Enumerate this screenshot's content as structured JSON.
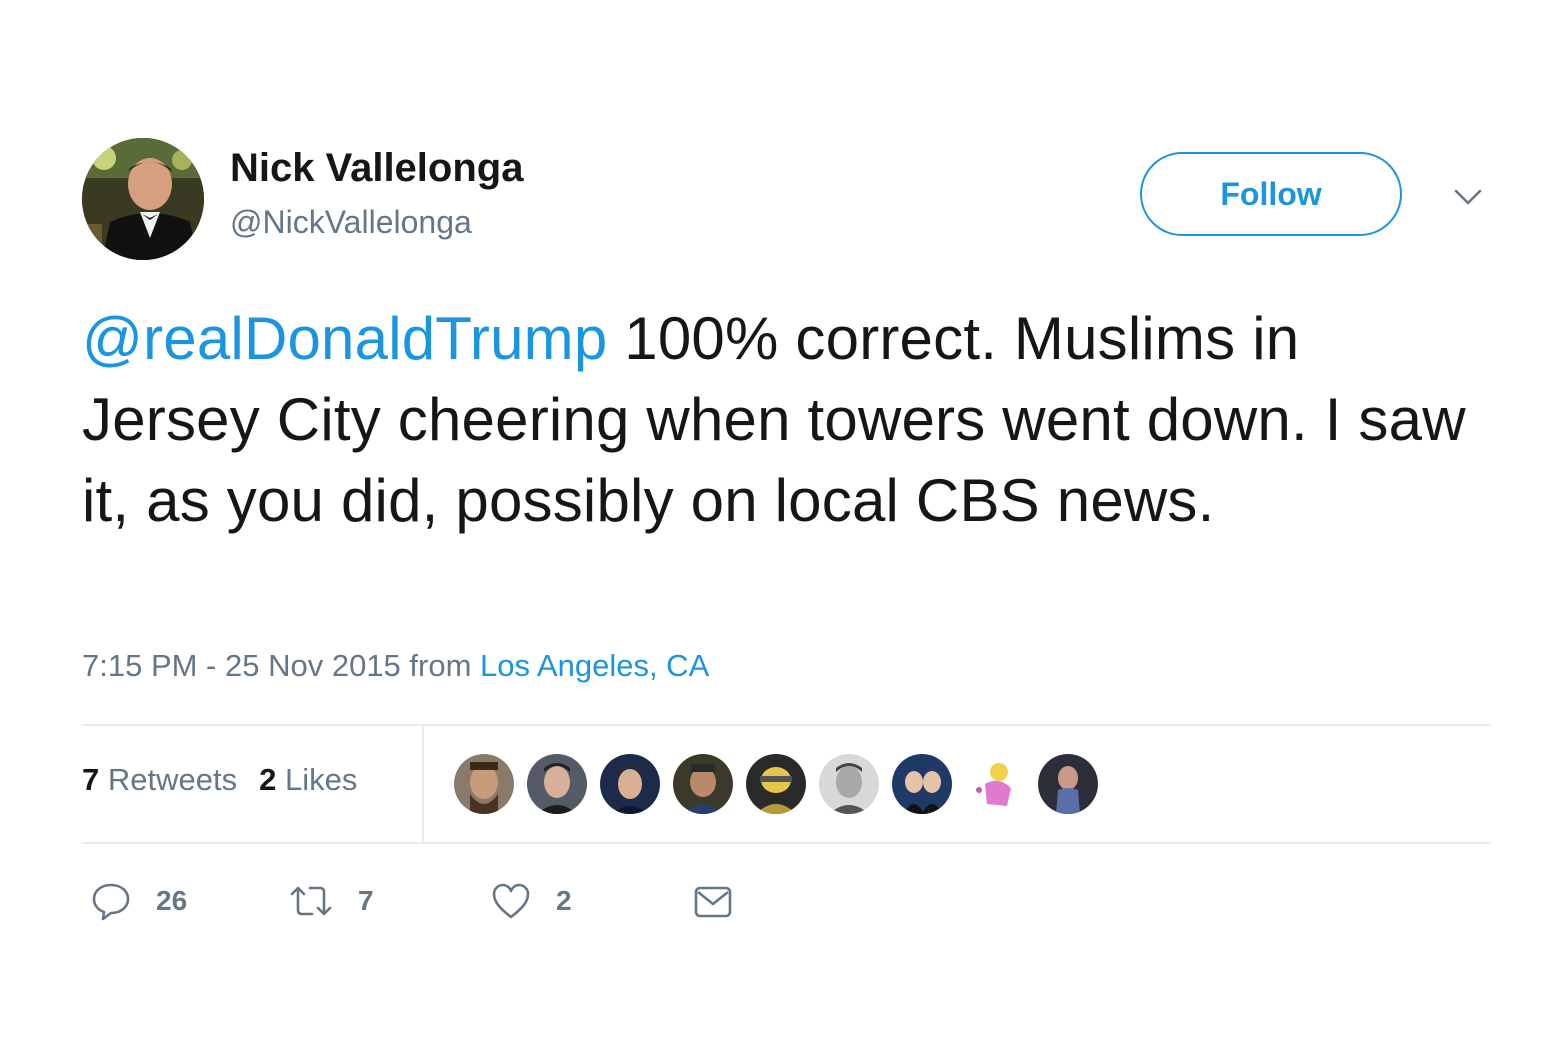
{
  "user": {
    "display_name": "Nick Vallelonga",
    "screen_name": "@NickVallelonga"
  },
  "header": {
    "follow_label": "Follow"
  },
  "tweet": {
    "mention": "@realDonaldTrump",
    "body": " 100% correct.  Muslims in Jersey City cheering when towers went down. I saw it, as you did, possibly on local CBS news.",
    "time": "7:15 PM - 25 Nov 2015",
    "from_label": "from",
    "location": "Los Angeles, CA"
  },
  "stats": {
    "retweets_count": "7",
    "retweets_label": "Retweets",
    "likes_count": "2",
    "likes_label": "Likes"
  },
  "likers": [
    {
      "icon": "user-avatar"
    },
    {
      "icon": "user-avatar"
    },
    {
      "icon": "user-avatar"
    },
    {
      "icon": "user-avatar"
    },
    {
      "icon": "user-avatar"
    },
    {
      "icon": "user-avatar"
    },
    {
      "icon": "user-avatar"
    },
    {
      "icon": "user-avatar"
    },
    {
      "icon": "user-avatar"
    }
  ],
  "actions": {
    "reply_count": "26",
    "retweet_count": "7",
    "like_count": "2"
  },
  "colors": {
    "link": "#1b95e0",
    "muted": "#657786",
    "text": "#14171a",
    "divider": "#e6ecf0"
  }
}
